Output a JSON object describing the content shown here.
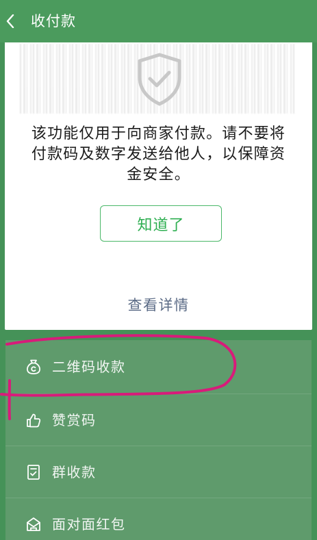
{
  "header": {
    "title": "收付款",
    "back_icon": "chevron-left-icon"
  },
  "dialog": {
    "icon": "shield-check-icon",
    "message_lines": [
      "该功能仅用于向商家付款。请不要将",
      "付款码及数字发送给他人，以保障资",
      "金安全。"
    ],
    "confirm_label": "知道了",
    "details_link": "查看详情"
  },
  "menu": {
    "items": [
      {
        "label": "二维码收款",
        "icon": "money-bag-icon"
      },
      {
        "label": "赞赏码",
        "icon": "thumbs-up-icon"
      },
      {
        "label": "群收款",
        "icon": "group-collect-icon"
      },
      {
        "label": "面对面红包",
        "icon": "red-packet-icon"
      }
    ]
  },
  "colors": {
    "header": "#4b9b5d",
    "backdrop": "#459258",
    "menu_row": "#5f9b6c",
    "accent_green": "#2dae50",
    "link": "#5b6b86",
    "shield_gray": "#c8c8c8",
    "annotation": "#d81b7a"
  }
}
